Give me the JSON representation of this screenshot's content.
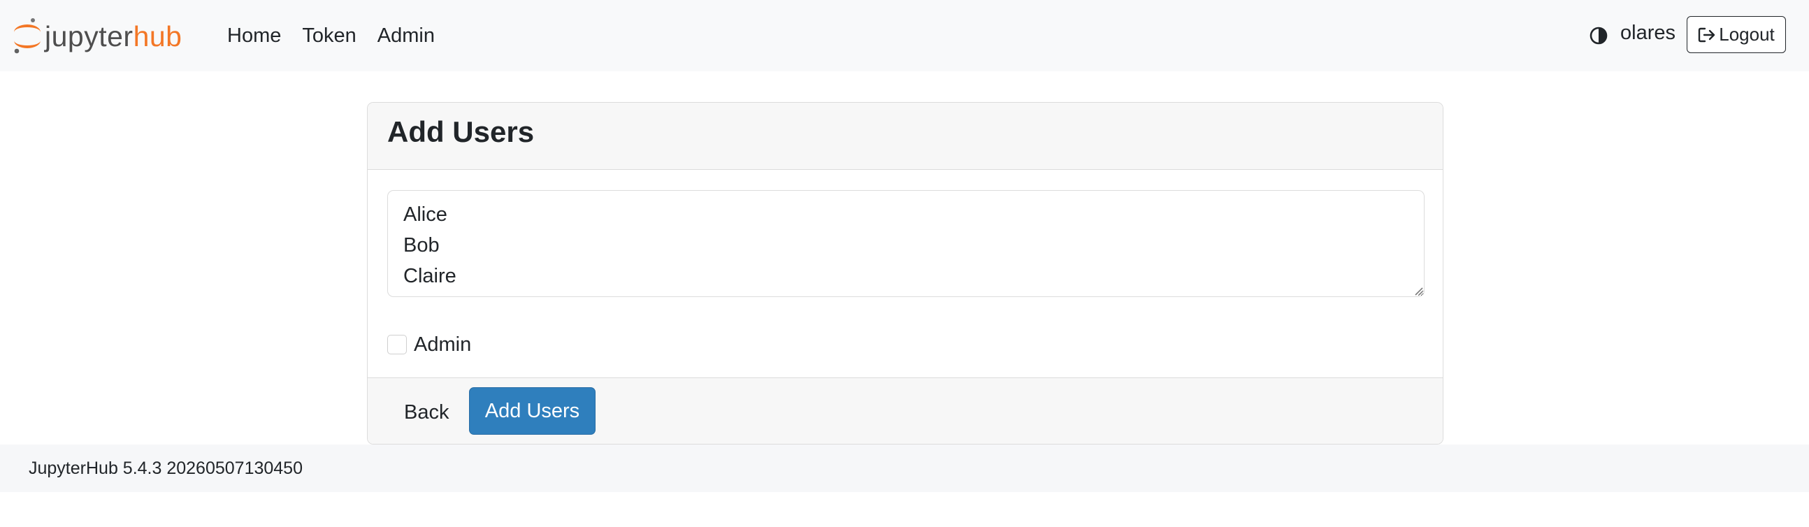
{
  "navbar": {
    "logo": {
      "jupyter": "jupyter",
      "hub": "hub"
    },
    "links": [
      "Home",
      "Token",
      "Admin"
    ],
    "theme_icon": "half-circle-contrast-icon",
    "username": "olares",
    "logout_label": "Logout",
    "logout_icon": "sign-out-icon"
  },
  "card": {
    "title": "Add Users",
    "textarea_value": "Alice\nBob\nClaire",
    "admin_label": "Admin",
    "admin_checked": false,
    "back_label": "Back",
    "submit_label": "Add Users"
  },
  "footer": {
    "version": "JupyterHub 5.4.3 20260507130450"
  },
  "colors": {
    "brand_orange": "#f37726",
    "primary_button": "#2f7fbd"
  }
}
